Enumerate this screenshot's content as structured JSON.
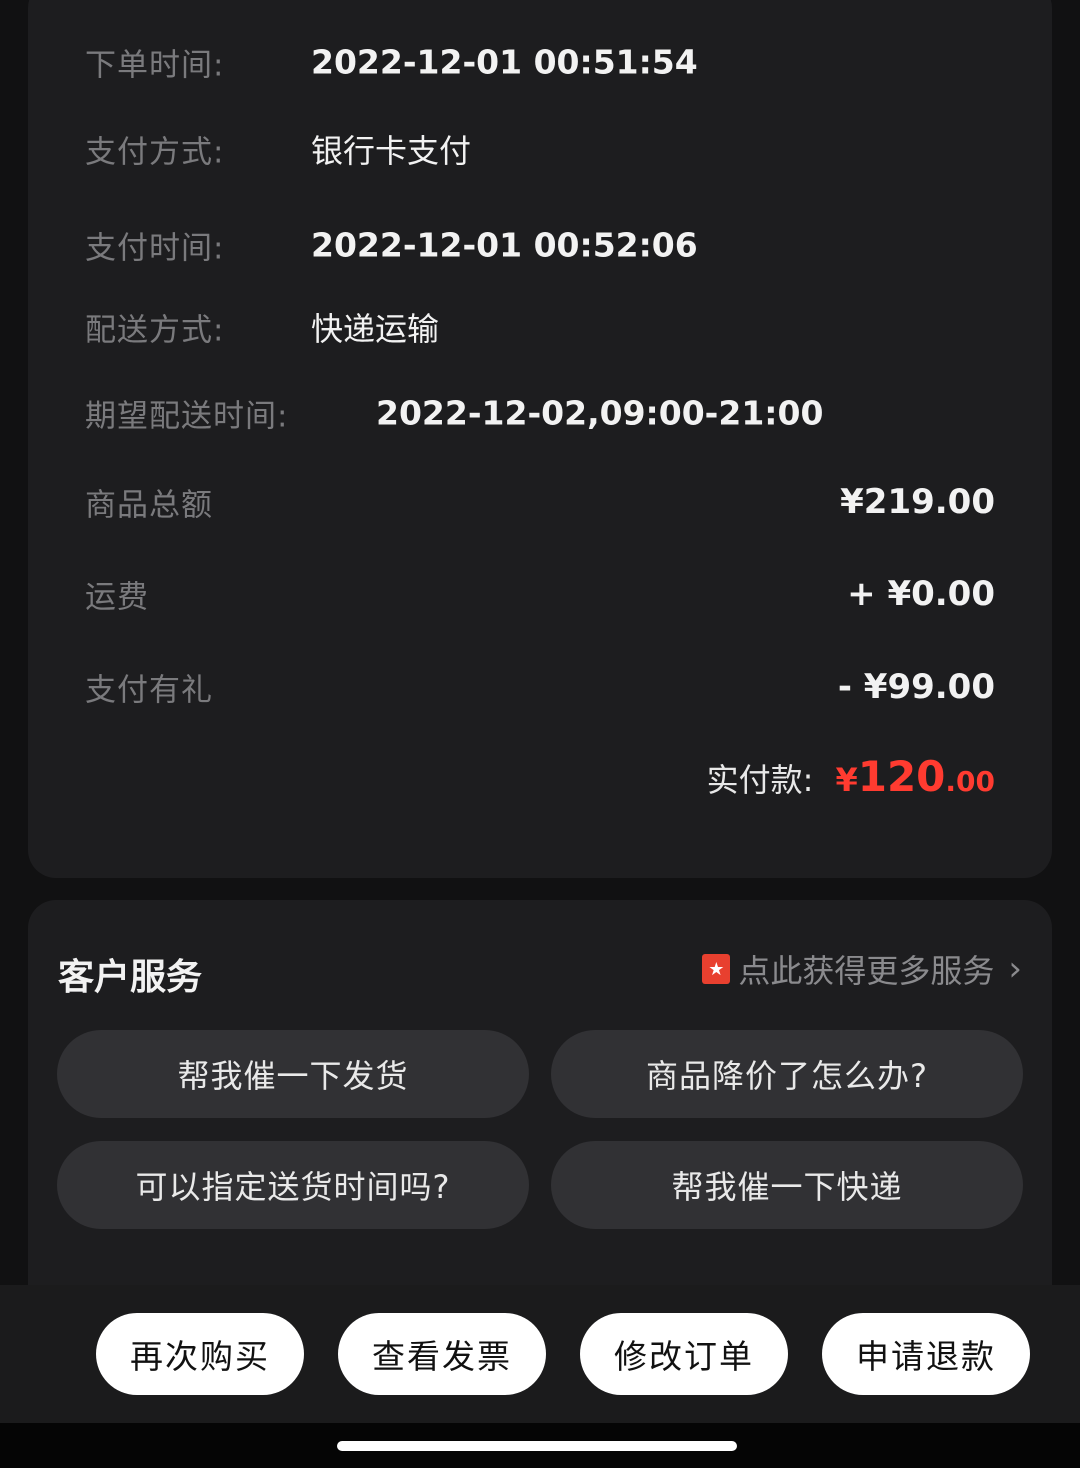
{
  "order_info": {
    "order_time": {
      "label": "下单时间:",
      "value": "2022-12-01 00:51:54"
    },
    "payment_method": {
      "label": "支付方式:",
      "value": "银行卡支付"
    },
    "payment_time": {
      "label": "支付时间:",
      "value": "2022-12-01 00:52:06"
    },
    "delivery_method": {
      "label": "配送方式:",
      "value": "快递运输"
    },
    "expected_delivery": {
      "label": "期望配送时间:",
      "value": "2022-12-02,09:00-21:00"
    }
  },
  "amounts": {
    "goods_total": {
      "label": "商品总额",
      "value": "¥219.00"
    },
    "shipping": {
      "label": "运费",
      "value": "+ ¥0.00"
    },
    "payment_gift": {
      "label": "支付有礼",
      "value": "- ¥99.00"
    },
    "paid": {
      "label": "实付款:",
      "currency": "¥",
      "integer": "120",
      "decimal": ".00"
    }
  },
  "service": {
    "title": "客户服务",
    "more_link": "点此获得更多服务",
    "more_icon": "coupon-star-icon",
    "chevron": "›",
    "questions": [
      "帮我催一下发货",
      "商品降价了怎么办?",
      "可以指定送货时间吗?",
      "帮我催一下快递"
    ]
  },
  "actions": [
    "再次购买",
    "查看发票",
    "修改订单",
    "申请退款"
  ],
  "colors": {
    "accent": "#ff3b30",
    "background": "#111112",
    "card": "#1d1d1f",
    "button": "#313134"
  }
}
